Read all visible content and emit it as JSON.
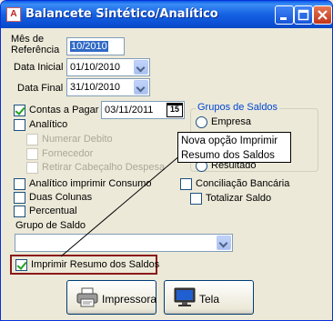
{
  "window": {
    "title": "Balancete Sintético/Analítico",
    "icon_letter": "A"
  },
  "form": {
    "mes_label": "Mês de Referência",
    "mes_value": "10/2010",
    "data_inicial_label": "Data Inicial",
    "data_inicial_value": "01/10/2010",
    "data_final_label": "Data Final",
    "data_final_value": "31/10/2010",
    "contas_label": "Contas a Pagar",
    "contas_date": "03/11/2011",
    "calendar_day": "15",
    "analitico_label": "Analítico",
    "numerar_label": "Numerar Debito",
    "fornecedor_label": "Fornecedor",
    "retirar_label": "Retirar Cabeçalho Despesa",
    "grupos_title": "Grupos de Saldos",
    "empresa_label": "Empresa",
    "resultado_label": "Resultado",
    "analitico_consumo_label": "Analítico imprimir Consumo",
    "conciliacao_label": "Conciliação Bancária",
    "duas_colunas_label": "Duas Colunas",
    "totalizar_label": "Totalizar Saldo",
    "percentual_label": "Percentual",
    "grupo_saldo_label": "Grupo de Saldo",
    "grupo_saldo_value": "",
    "imprimir_resumo_label": "Imprimir Resumo dos Saldos"
  },
  "callout": {
    "line1": "Nova opção Imprimir",
    "line2": "Resumo dos Saldos"
  },
  "buttons": {
    "impressora": "Impressora",
    "tela": "Tela"
  }
}
